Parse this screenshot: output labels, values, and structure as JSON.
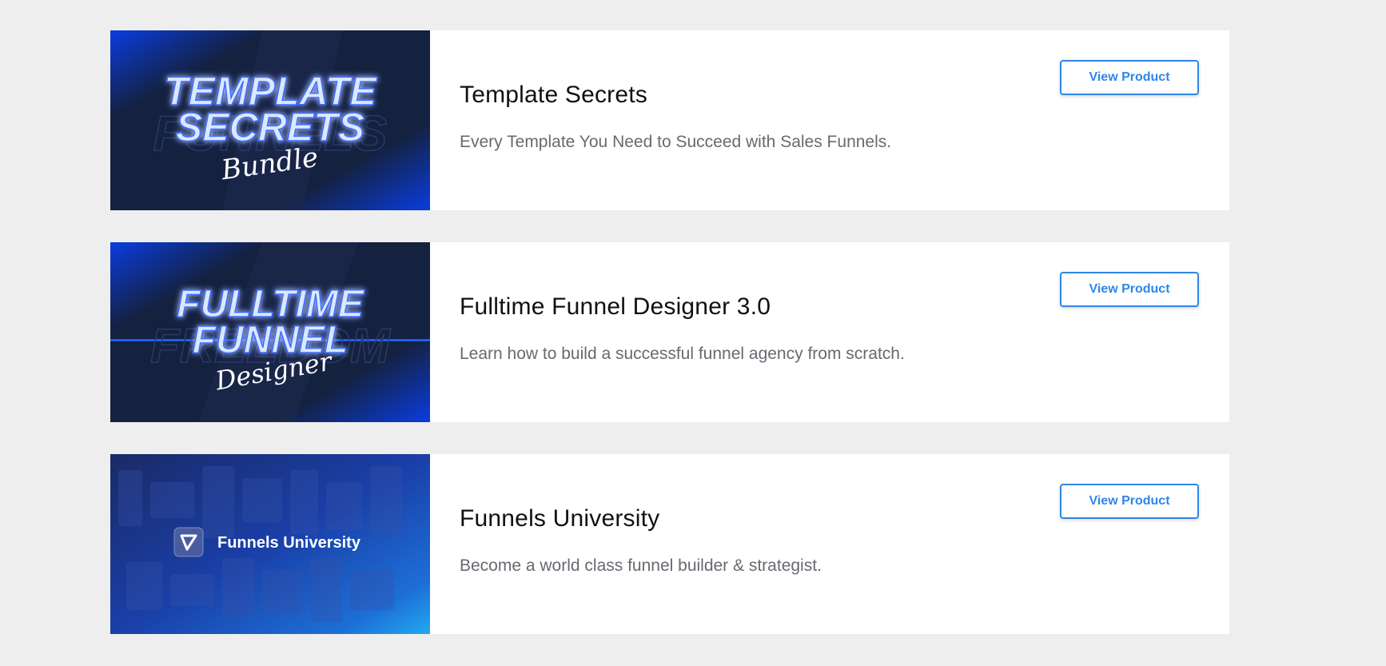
{
  "products": [
    {
      "title": "Template Secrets",
      "description": "Every Template You Need to Succeed with Sales Funnels.",
      "button_label": "View Product",
      "thumbnail": {
        "line1": "TEMPLATE",
        "line2": "SECRETS",
        "script": "Bundle",
        "watermark": "FUNNELS"
      }
    },
    {
      "title": "Fulltime Funnel Designer 3.0",
      "description": "Learn how to build a successful funnel agency from scratch.",
      "button_label": "View Product",
      "thumbnail": {
        "line1": "FULLTIME",
        "line2": "FUNNEL",
        "script": "Designer",
        "watermark": "FREEDOM"
      }
    },
    {
      "title": "Funnels University",
      "description": "Become a world class funnel builder & strategist.",
      "button_label": "View Product",
      "thumbnail": {
        "brand": "Funnels University"
      }
    }
  ],
  "colors": {
    "background": "#eeeeee",
    "card": "#ffffff",
    "accent": "#2f86e8",
    "thumb_dark": "#14213f",
    "thumb_blue": "#0a3de0"
  }
}
